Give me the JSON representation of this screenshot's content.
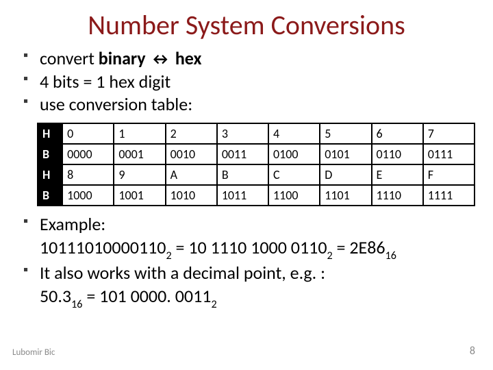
{
  "title": "Number System Conversions",
  "bullets_top": [
    {
      "pre": "convert ",
      "bold1": "binary ",
      "arrow": "↔",
      "bold2": " hex"
    },
    {
      "pre": "4 bits = 1 hex digit"
    },
    {
      "pre": "use conversion table:"
    }
  ],
  "table": {
    "head1": "H",
    "head2": "B",
    "row1": [
      "0",
      "1",
      "2",
      "3",
      "4",
      "5",
      "6",
      "7"
    ],
    "row2": [
      "0000",
      "0001",
      "0010",
      "0011",
      "0100",
      "0101",
      "0110",
      "0111"
    ],
    "row3": [
      "8",
      "9",
      "A",
      "B",
      "C",
      "D",
      "E",
      "F"
    ],
    "row4": [
      "1000",
      "1001",
      "1010",
      "1011",
      "1100",
      "1101",
      "1110",
      "1111"
    ]
  },
  "example": {
    "label": "Example:",
    "line1_a": "10111010000110",
    "line1_sub1": "2",
    "line1_b": " = 10 1110 1000 0110",
    "line1_sub2": "2",
    "line1_c": " = 2E86",
    "line1_sub3": "16",
    "bullet2_a": "It also works with a decimal point, e.g. :",
    "line2_a": "50.3",
    "line2_sub1": "16",
    "line2_b": " = 101 0000. 0011",
    "line2_sub2": "2"
  },
  "footer_left": "Lubomir Bic",
  "footer_right": "8"
}
